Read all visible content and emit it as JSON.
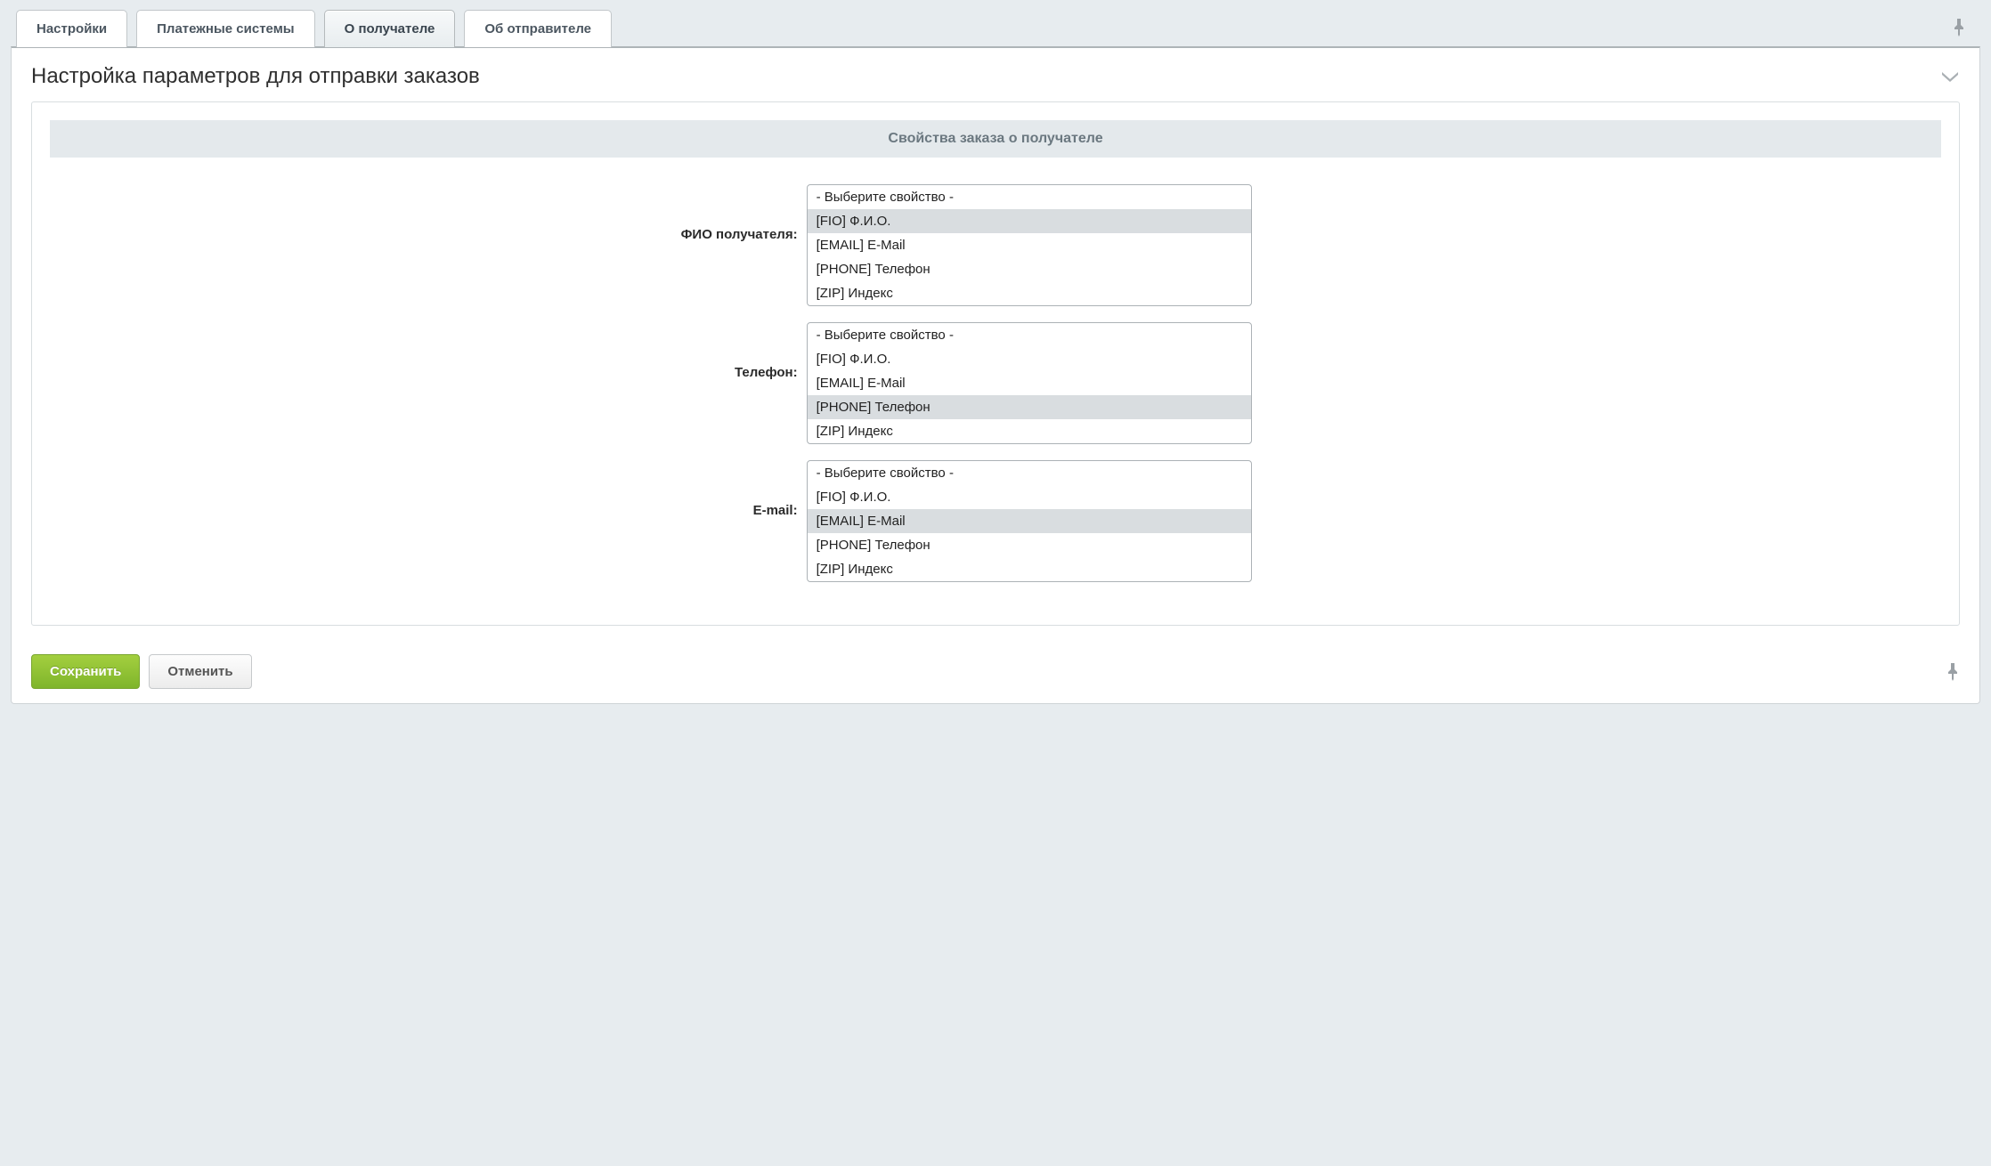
{
  "tabs": [
    {
      "label": "Настройки",
      "active": false
    },
    {
      "label": "Платежные системы",
      "active": false
    },
    {
      "label": "О получателе",
      "active": true
    },
    {
      "label": "Об отправителе",
      "active": false
    }
  ],
  "panel": {
    "title": "Настройка параметров для отправки заказов",
    "section_header": "Свойства заказа о получателе"
  },
  "fields": [
    {
      "label": "ФИО получателя:",
      "options": [
        {
          "text": "- Выберите свойство -",
          "selected": false
        },
        {
          "text": "[FIO] Ф.И.О.",
          "selected": true
        },
        {
          "text": "[EMAIL] E-Mail",
          "selected": false
        },
        {
          "text": "[PHONE] Телефон",
          "selected": false
        },
        {
          "text": "[ZIP] Индекс",
          "selected": false
        }
      ]
    },
    {
      "label": "Телефон:",
      "options": [
        {
          "text": "- Выберите свойство -",
          "selected": false
        },
        {
          "text": "[FIO] Ф.И.О.",
          "selected": false
        },
        {
          "text": "[EMAIL] E-Mail",
          "selected": false
        },
        {
          "text": "[PHONE] Телефон",
          "selected": true
        },
        {
          "text": "[ZIP] Индекс",
          "selected": false
        }
      ]
    },
    {
      "label": "E-mail:",
      "options": [
        {
          "text": "- Выберите свойство -",
          "selected": false
        },
        {
          "text": "[FIO] Ф.И.О.",
          "selected": false
        },
        {
          "text": "[EMAIL] E-Mail",
          "selected": true
        },
        {
          "text": "[PHONE] Телефон",
          "selected": false
        },
        {
          "text": "[ZIP] Индекс",
          "selected": false
        }
      ]
    }
  ],
  "buttons": {
    "save": "Сохранить",
    "cancel": "Отменить"
  }
}
